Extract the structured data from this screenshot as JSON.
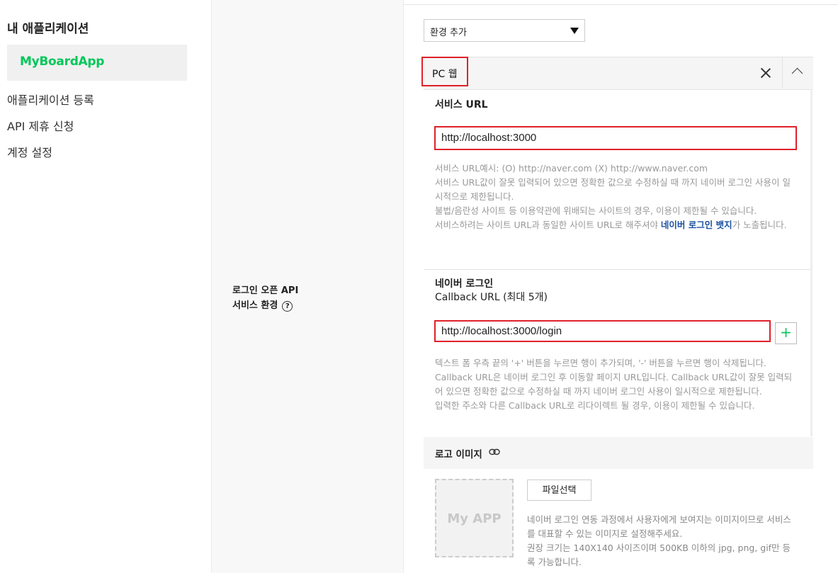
{
  "sidebar": {
    "title": "내 애플리케이션",
    "app_name": "MyBoardApp",
    "links": [
      "애플리케이션 등록",
      "API 제휴 신청",
      "계정 설정"
    ]
  },
  "env_section": {
    "label_line1": "로그인 오픈 API",
    "label_line2": "서비스 환경",
    "help_icon": "?"
  },
  "environment_select": {
    "value": "환경 추가"
  },
  "pc_web": {
    "title": "PC 웹",
    "service_url": {
      "label": "서비스 URL",
      "value": "http://localhost:3000",
      "help": [
        "서비스 URL예시: (O) http://naver.com (X) http://www.naver.com",
        "서비스 URL값이 잘못 입력되어 있으면 정확한 값으로 수정하실 때 까지 네이버 로그인 사용이 일시적으로 제한됩니다.",
        "불법/음란성 사이트 등 이용약관에 위배되는 사이트의 경우, 이용이 제한될 수 있습니다."
      ],
      "help_last_pre": "서비스하려는 사이트 URL과 동일한 사이트 URL로 해주셔야 ",
      "help_last_bold": "네이버 로그인 뱃지",
      "help_last_post": "가 노출됩니다."
    },
    "callback": {
      "label_line1": "네이버 로그인",
      "label_line2": "Callback URL (최대 5개)",
      "value": "http://localhost:3000/login",
      "add_label": "+",
      "help": [
        "텍스트 폼 우측 끝의 '+' 버튼을 누르면 행이 추가되며, '-' 버튼을 누르면 행이 삭제됩니다.",
        "Callback URL은 네이버 로그인 후 이동할 페이지 URL입니다. Callback URL값이 잘못 입력되어 있으면 정확한 값으로 수정하실 때 까지 네이버 로그인 사용이 일시적으로 제한됩니다.",
        "입력한 주소와 다른 Callback URL로 리다이렉트 될 경우, 이용이 제한될 수 있습니다."
      ]
    }
  },
  "logo": {
    "title": "로고 이미지",
    "placeholder": "My APP",
    "file_button": "파일선택",
    "help": [
      "네이버 로그인 연동 과정에서 사용자에게 보여지는 이미지이므로 서비스를 대표할 수 있는 이미지로 설정해주세요.",
      "권장 크기는 140X140 사이즈이며 500KB 이하의 jpg, png, gif만 등록 가능합니다."
    ]
  },
  "colors": {
    "accent": "#03c75a",
    "highlight": "#e0202a",
    "link": "#1b4fa0"
  },
  "icons": [
    "close-icon",
    "chevron-up-icon",
    "help-icon",
    "link-icon",
    "plus-icon",
    "dropdown-arrow-icon"
  ]
}
